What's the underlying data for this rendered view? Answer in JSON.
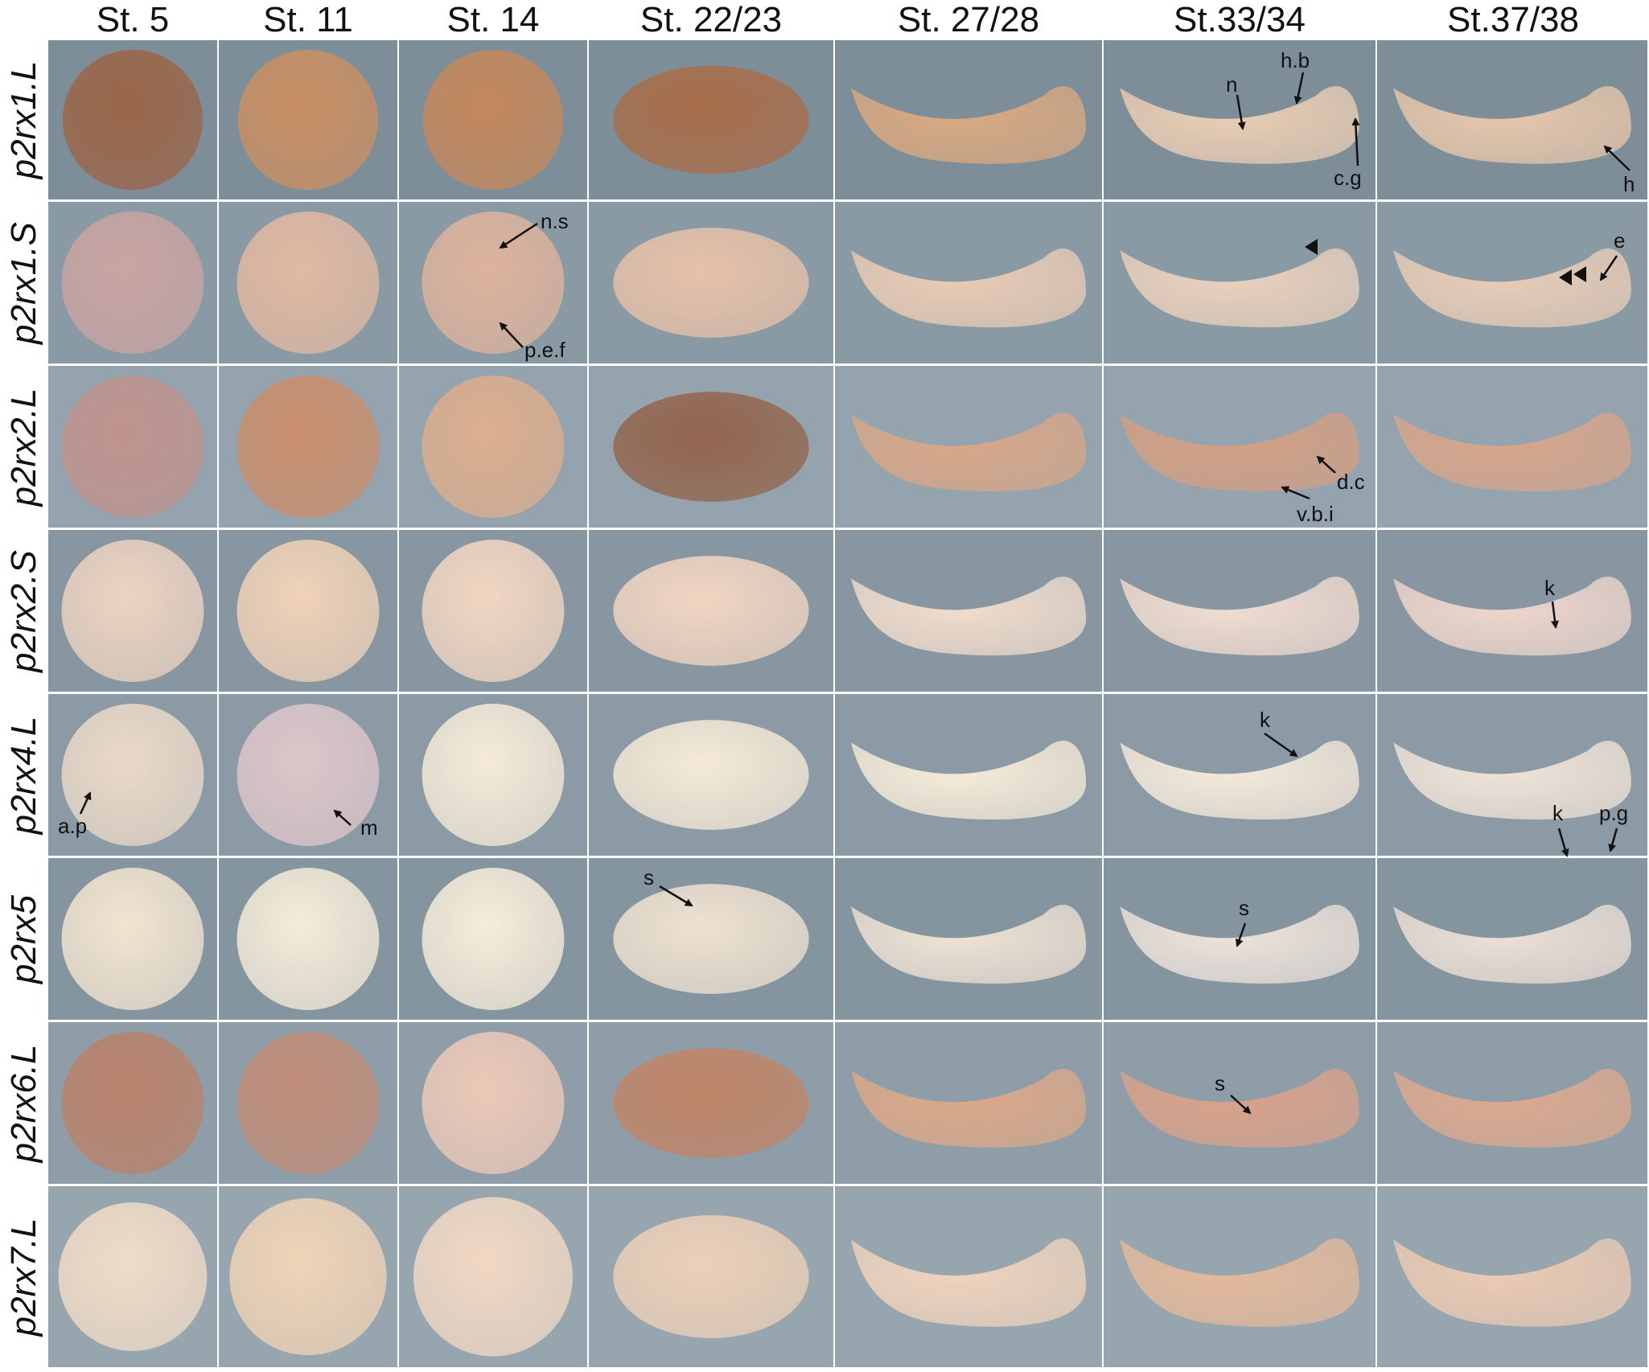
{
  "columns": [
    "St. 5",
    "St. 11",
    "St. 14",
    "St. 22/23",
    "St. 27/28",
    "St.33/34",
    "St.37/38"
  ],
  "rows": [
    "p2rx1.L",
    "p2rx1.S",
    "p2rx2.L",
    "p2rx2.S",
    "p2rx4.L",
    "p2rx5",
    "p2rx6.L",
    "p2rx7.L"
  ],
  "annotations": {
    "n": "n",
    "hb": "h.b",
    "cg": "c.g",
    "h": "h",
    "ns": "n.s",
    "pef": "p.e.f",
    "e": "e",
    "dc": "d.c",
    "vbi": "v.b.i",
    "k": "k",
    "ap": "a.p",
    "m": "m",
    "pg": "p.g",
    "s": "s"
  },
  "colors": {
    "background": "#8a9aa6",
    "embryo_light": "#f1e3d2",
    "embryo_brown": "#b47a52",
    "stain": "#4a2f7a",
    "text": "#111111"
  }
}
